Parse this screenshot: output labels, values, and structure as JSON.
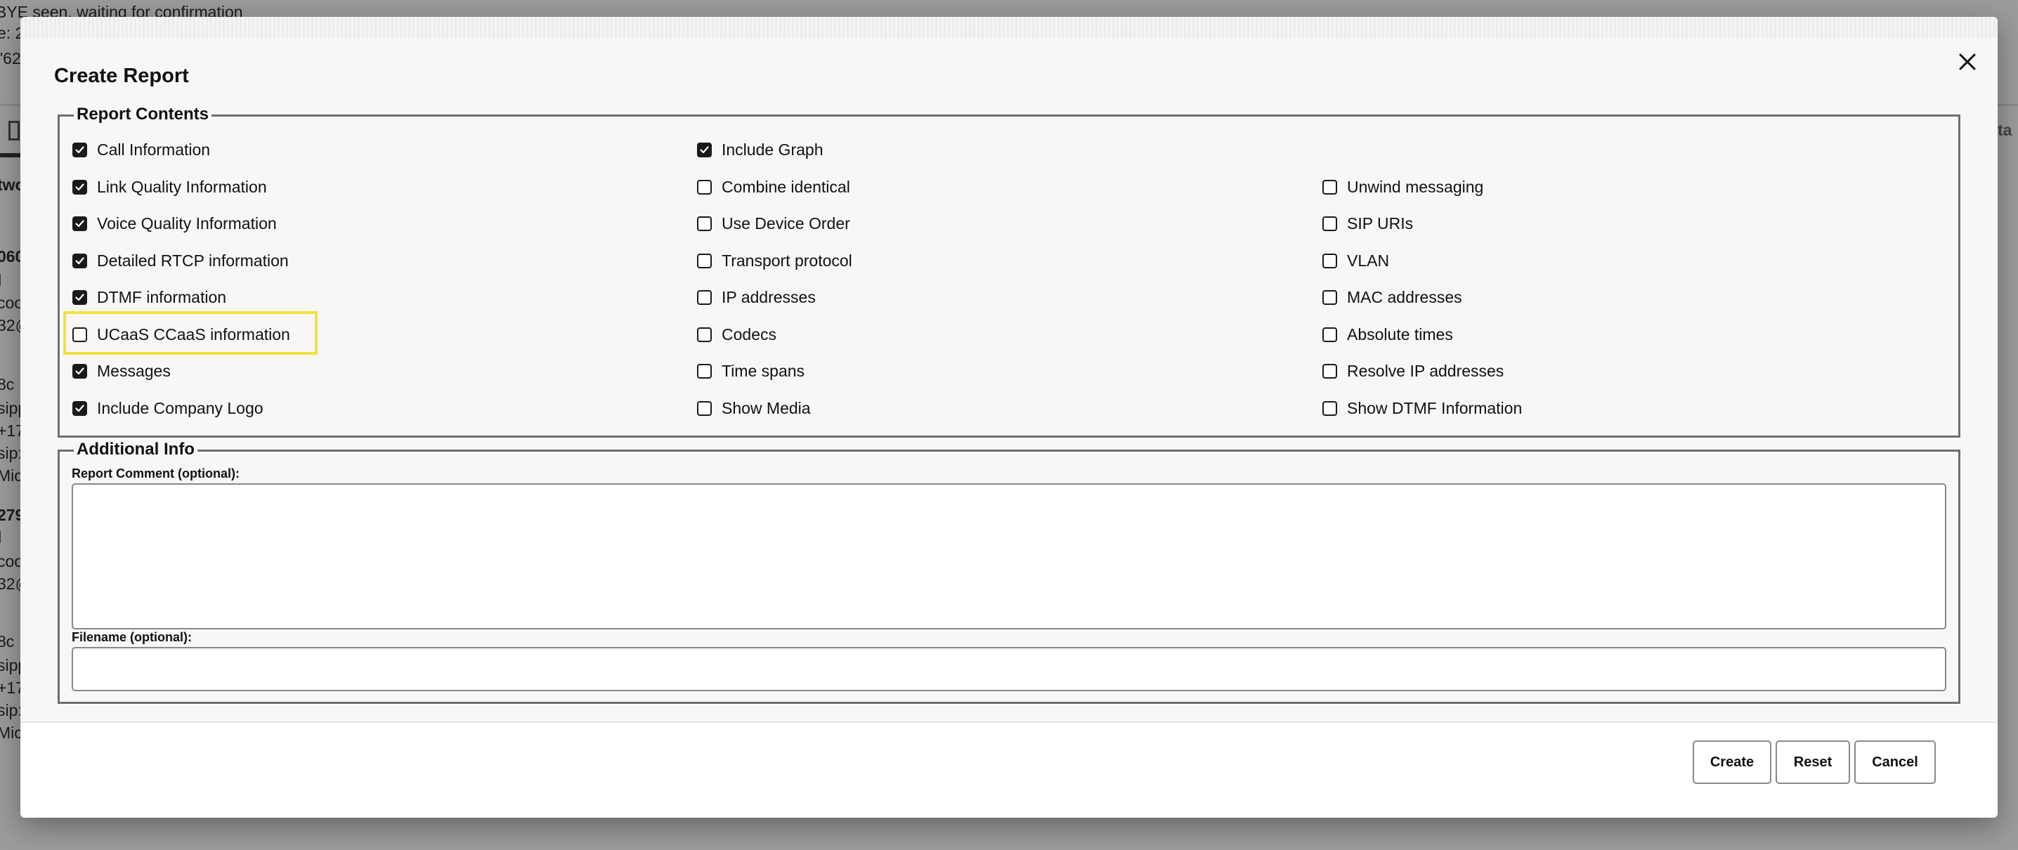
{
  "background": {
    "status_line": "BYE seen, waiting for confirmation",
    "fragments_left": [
      "e: 2",
      "\"62",
      "two",
      "060",
      "l",
      "coo",
      "32@",
      "8c",
      "sipp",
      "+17",
      "sip:",
      "Mic",
      "279",
      "l",
      "coo",
      "32@",
      "8c",
      "sipp",
      "+17",
      "sip:",
      "Mic"
    ],
    "fragment_right": "ta"
  },
  "modal": {
    "title": "Create Report",
    "close_icon": "close-icon",
    "report_contents": {
      "legend": "Report Contents",
      "columns": [
        [
          {
            "label": "Call Information",
            "checked": true
          },
          {
            "label": "Link Quality Information",
            "checked": true
          },
          {
            "label": "Voice Quality Information",
            "checked": true
          },
          {
            "label": "Detailed RTCP information",
            "checked": true
          },
          {
            "label": "DTMF information",
            "checked": true
          },
          {
            "label": "UCaaS CCaaS information",
            "checked": false,
            "highlighted": true
          },
          {
            "label": "Messages",
            "checked": true
          },
          {
            "label": "Include Company Logo",
            "checked": true
          }
        ],
        [
          {
            "label": "Include Graph",
            "checked": true
          },
          {
            "label": "Combine identical",
            "checked": false
          },
          {
            "label": "Use Device Order",
            "checked": false
          },
          {
            "label": "Transport protocol",
            "checked": false
          },
          {
            "label": "IP addresses",
            "checked": false
          },
          {
            "label": "Codecs",
            "checked": false
          },
          {
            "label": "Time spans",
            "checked": false
          },
          {
            "label": "Show Media",
            "checked": false
          }
        ],
        [
          null,
          {
            "label": "Unwind messaging",
            "checked": false
          },
          {
            "label": "SIP URIs",
            "checked": false
          },
          {
            "label": "VLAN",
            "checked": false
          },
          {
            "label": "MAC addresses",
            "checked": false
          },
          {
            "label": "Absolute times",
            "checked": false
          },
          {
            "label": "Resolve IP addresses",
            "checked": false
          },
          {
            "label": "Show DTMF Information",
            "checked": false
          }
        ]
      ]
    },
    "additional_info": {
      "legend": "Additional Info",
      "comment_label": "Report Comment (optional):",
      "comment_value": "",
      "filename_label": "Filename (optional):",
      "filename_value": ""
    },
    "buttons": {
      "create": "Create",
      "reset": "Reset",
      "cancel": "Cancel"
    }
  },
  "colors": {
    "highlight": "#f2e23c",
    "overlay": "#9b9b9b",
    "modal_bg": "#f8f7f5"
  }
}
